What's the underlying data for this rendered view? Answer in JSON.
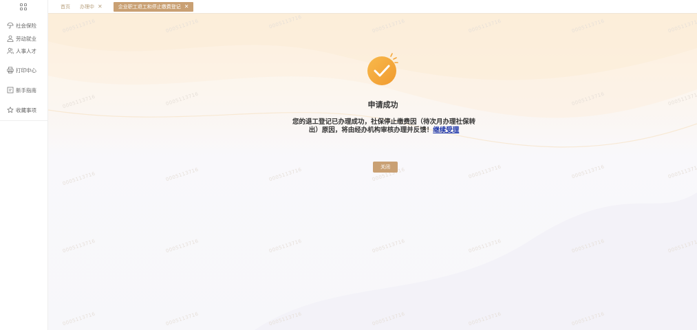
{
  "sidebar": {
    "items": [
      {
        "label": "社会保险",
        "icon": "umbrella-icon"
      },
      {
        "label": "劳动就业",
        "icon": "person-icon"
      },
      {
        "label": "人事人才",
        "icon": "people-icon"
      },
      {
        "label": "打印中心",
        "icon": "printer-icon"
      },
      {
        "label": "新手指南",
        "icon": "guide-icon"
      },
      {
        "label": "收藏事项",
        "icon": "star-icon"
      }
    ]
  },
  "tabs": [
    {
      "label": "首页",
      "closable": false
    },
    {
      "label": "办理中",
      "closable": true
    },
    {
      "label": "企业职工退工和停止缴费登记",
      "closable": true,
      "active": true
    }
  ],
  "watermark": "0005113716",
  "result": {
    "title": "申请成功",
    "message": "您的退工登记已办理成功，社保停止缴费因（待次月办理社保转出）原因，将由经办机构审核办理并反馈！",
    "link": "继续受理",
    "close_label": "关闭"
  },
  "colors": {
    "accent": "#c9a073",
    "check_orange": "#f4a63a",
    "link": "#1a33a8"
  }
}
